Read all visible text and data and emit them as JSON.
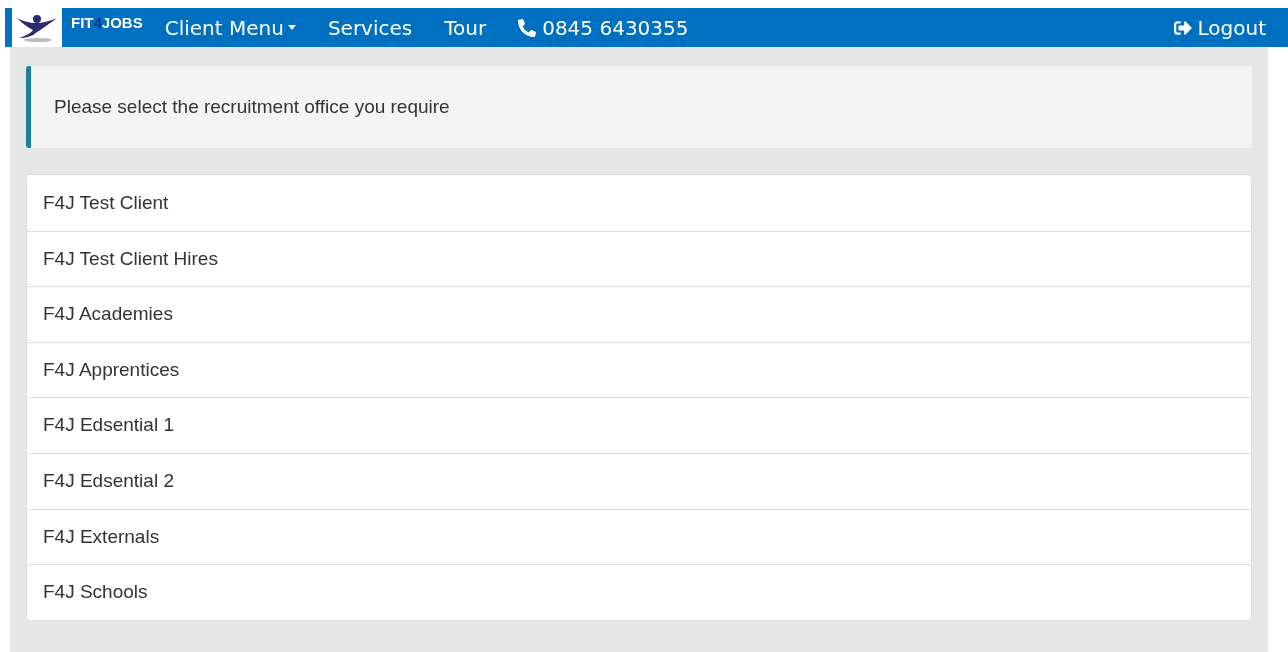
{
  "navbar": {
    "brand": {
      "prefix": "FIT",
      "number": "4",
      "suffix": "JOBS"
    },
    "items": [
      {
        "label": "Client Menu",
        "kind": "dropdown"
      },
      {
        "label": "Services",
        "kind": "link"
      },
      {
        "label": "Tour",
        "kind": "link"
      },
      {
        "label": "0845 6430355",
        "kind": "phone"
      }
    ],
    "logout": "Logout"
  },
  "notice": "Please select the recruitment office you require",
  "offices": [
    "F4J Test Client",
    "F4J Test Client Hires",
    "F4J Academies",
    "F4J Apprentices",
    "F4J Edsential 1",
    "F4J Edsential 2",
    "F4J Externals",
    "F4J Schools"
  ]
}
